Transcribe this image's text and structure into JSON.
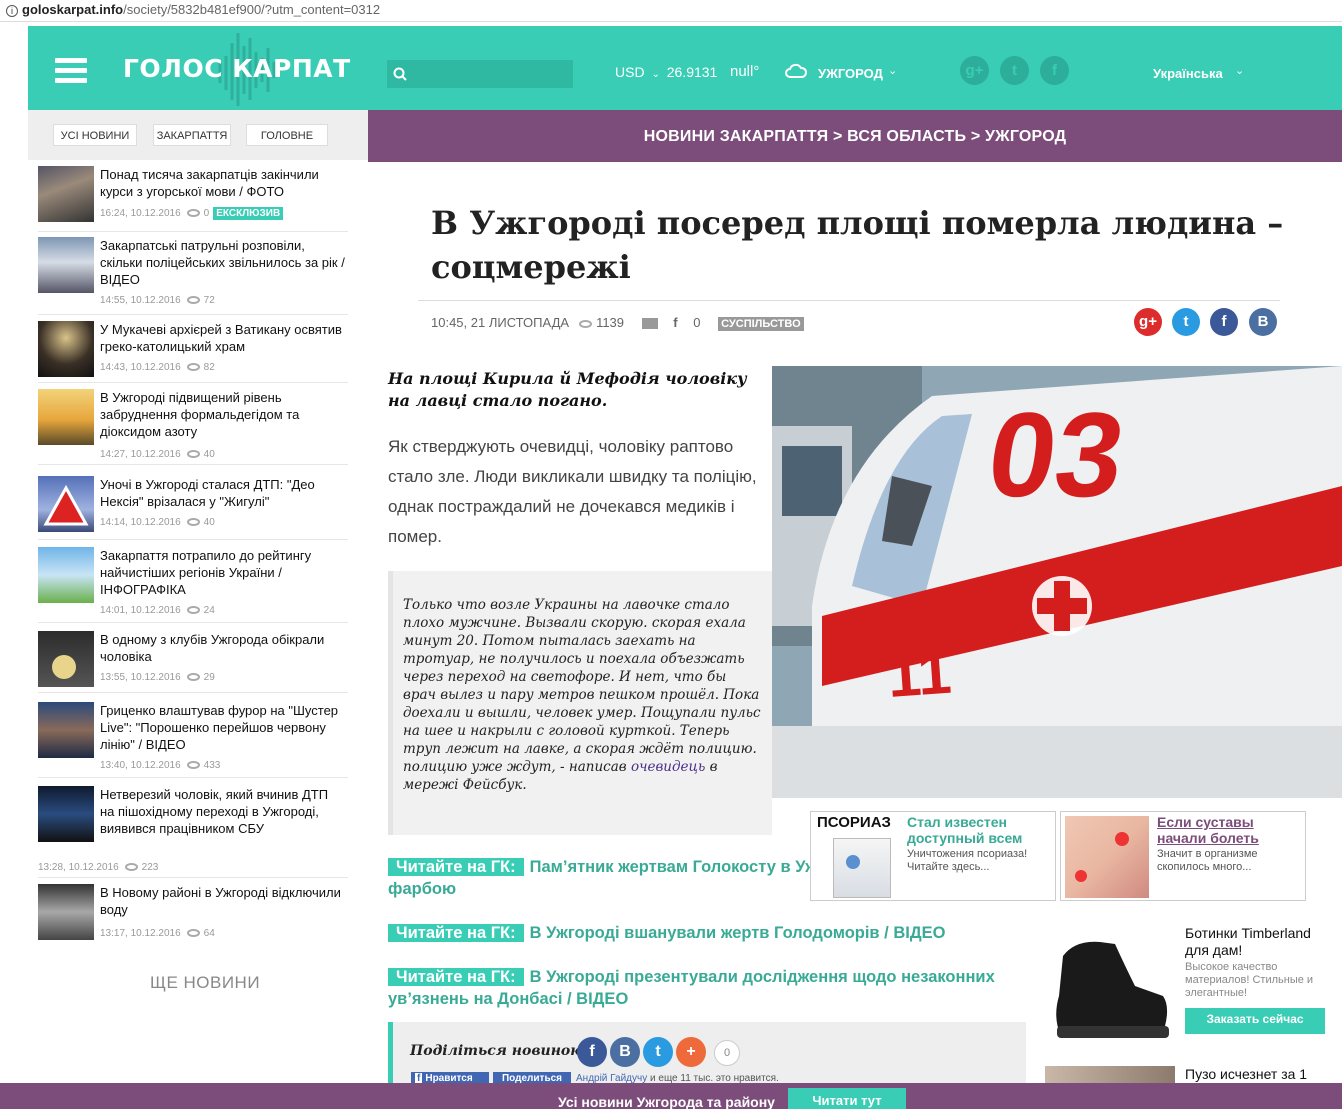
{
  "browser": {
    "url_domain": "goloskarpat.info",
    "url_rest": "/society/5832b481ef900/?utm_content=0312"
  },
  "header": {
    "logo": "ГОЛОС КАРПАТ",
    "currency_label": "USD",
    "currency_value": "26.9131",
    "temperature": "null°",
    "city": "УЖГОРОД",
    "language": "Українська",
    "social": [
      "g+",
      "t",
      "f"
    ]
  },
  "left_tabs": [
    "УСІ НОВИНИ",
    "ЗАКАРПАТТЯ",
    "ГОЛОВНЕ"
  ],
  "news": [
    {
      "title": "Понад тисяча закарпатців закінчили курси з угорської мови / ФОТО",
      "time": "16:24, 10.12.2016",
      "views": "0",
      "badge": "ЕКСКЛЮЗИВ"
    },
    {
      "title": "Закарпатські патрульні розповіли, скільки поліцейських звільнилось за рік / ВІДЕО",
      "time": "14:55, 10.12.2016",
      "views": "72"
    },
    {
      "title": "У Мукачеві архієрей з Ватикану освятив греко-католицький храм",
      "time": "14:43, 10.12.2016",
      "views": "82"
    },
    {
      "title": "В Ужгороді підвищений рівень забруднення формальдегідом та діоксидом азоту",
      "time": "14:27, 10.12.2016",
      "views": "40"
    },
    {
      "title": "Уночі в Ужгороді сталася ДТП: \"Део Нексія\" врізалася у \"Жигулі\"",
      "time": "14:14, 10.12.2016",
      "views": "40"
    },
    {
      "title": "Закарпаття потрапило до рейтингу найчистіших регіонів України / ІНФОГРАФІКА",
      "time": "14:01, 10.12.2016",
      "views": "24"
    },
    {
      "title": "В одному з клубів Ужгорода обікрали чоловіка",
      "time": "13:55, 10.12.2016",
      "views": "29"
    },
    {
      "title": "Гриценко влаштував фурор на \"Шустер Live\": \"Порошенко перейшов червону лінію\" / ВІДЕО",
      "time": "13:40, 10.12.2016",
      "views": "433"
    },
    {
      "title": "Нетверезий чоловік, який вчинив ДТП на пішохідному переході в Ужгороді, виявився працівником СБУ",
      "time": "13:28, 10.12.2016",
      "views": "223"
    },
    {
      "title": "В Новому районі в Ужгороді відключили воду",
      "time": "13:17, 10.12.2016",
      "views": "64"
    }
  ],
  "more_news": "ЩЕ НОВИНИ",
  "breadcrumb": "НОВИНИ ЗАКАРПАТТЯ > ВСЯ ОБЛАСТЬ > УЖГОРОД",
  "article": {
    "title": "В Ужгороді посеред площі померла людина – соцмережі",
    "date": "10:45, 21 ЛИСТОПАДА",
    "views": "1139",
    "fb_count": "0",
    "tag": "СУСПІЛЬСТВО",
    "lead": "На площі Кирила й Мефодія чоловіку на лавці стало погано.",
    "body": "Як стверджують очевидці, чоловіку раптово стало зле. Люди викликали швидку та поліцію, однак постраждалий не дочекався медиків і помер.",
    "quote_before": "Только что возле Украины на лавочке стало плохо мужчине. Вызвали скорую. скорая ехала минут 20. Потом пыталась заехать на тротуар, не получилось и поехала объезжать через переход на светофоре. И нет, что бы врач вылез и пару метров пешком прошёл. Пока доехали и вышли, человек умер. Пощупали пульс на шее и накрыли с головой курткой. Теперь труп лежит на лавке, а скорая ждёт полицию. полицию уже ж",
    "quote_link": "очевидець",
    "quote_after": " в мережі Фейсбук.",
    "quote_mid": "дут, - написав "
  },
  "read_also": {
    "label": "Читайте на ГК:",
    "items": [
      "Пам’ятник жертвам Голокосту в Ужгороді облили червоною фарбою",
      "В Ужгороді вшанували жертв Голодоморів / ВІДЕО",
      "В Ужгороді презентували дослідження щодо незаконних ув’язнень на Донбасі / ВІДЕО"
    ]
  },
  "ads": {
    "psoriaz_word": "ПСОРИАЗ",
    "psoriaz_title": "Стал известен доступный всем",
    "psoriaz_sub": "Уничтожения псориаза! Читайте здесь...",
    "joints_title": "Если суставы начали болеть",
    "joints_sub": "Значит в организме скопилось много...",
    "boots_title": "Ботинки Timberland для дам!",
    "boots_sub": "Высокое качество материалов! Стильные и элегантные!",
    "boots_btn": "Заказать сейчас",
    "belly_title": "Пузо исчезнет за 1"
  },
  "share": {
    "label": "Поділіться новиною:",
    "count": "0",
    "like": "Нравится",
    "share_btn": "Поделиться",
    "like_text_name": "Андрій Гайдучу",
    "like_text_rest": " и еще 11 тыс. это нравится."
  },
  "bottom_bar": {
    "text": "Усі новини Ужгорода та району",
    "button": "Читати тут"
  },
  "colors": {
    "teal": "#39cdb5",
    "purple": "#7c4d7a"
  }
}
